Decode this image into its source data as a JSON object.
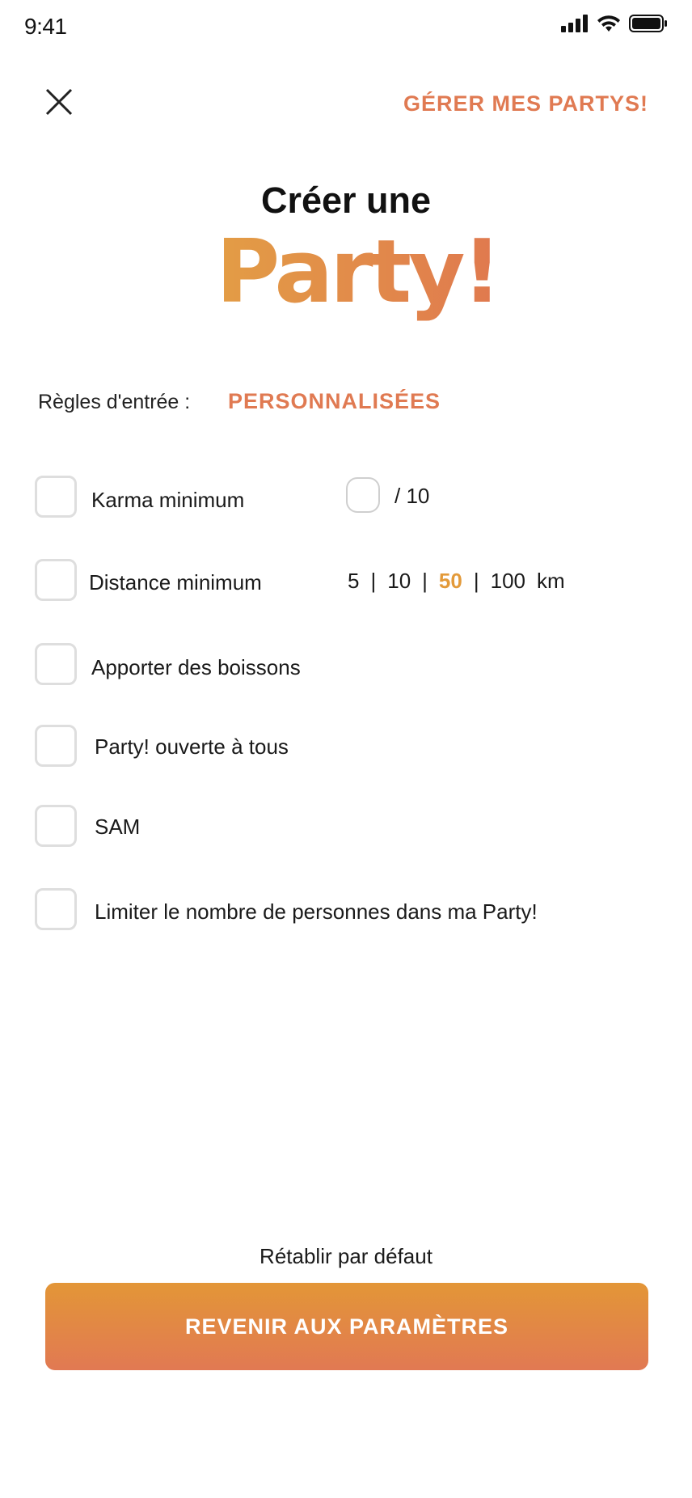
{
  "status_bar": {
    "time": "9:41"
  },
  "header": {
    "manage_link": "GÉRER MES PARTYS!"
  },
  "title": {
    "line1": "Créer une",
    "logo_text": "Party!"
  },
  "rules": {
    "label": "Règles d'entrée :",
    "value": "PERSONNALISÉES"
  },
  "options": {
    "karma": {
      "label": "Karma minimum",
      "suffix": "/ 10",
      "value": ""
    },
    "distance": {
      "label": "Distance minimum",
      "choices": [
        "5",
        "10",
        "50",
        "100"
      ],
      "selected": "50",
      "unit": "km"
    },
    "drinks": {
      "label": "Apporter des boissons"
    },
    "open": {
      "label": "Party! ouverte à tous"
    },
    "sam": {
      "label": "SAM"
    },
    "limit": {
      "label": "Limiter le nombre de personnes dans ma Party!"
    }
  },
  "footer": {
    "reset_label": "Rétablir par défaut",
    "cta_label": "REVENIR AUX PARAMÈTRES"
  },
  "colors": {
    "accent": "#e07a52",
    "accent_orange": "#e39a3a",
    "gradient_top": "#e39637",
    "gradient_bottom": "#e17953"
  }
}
